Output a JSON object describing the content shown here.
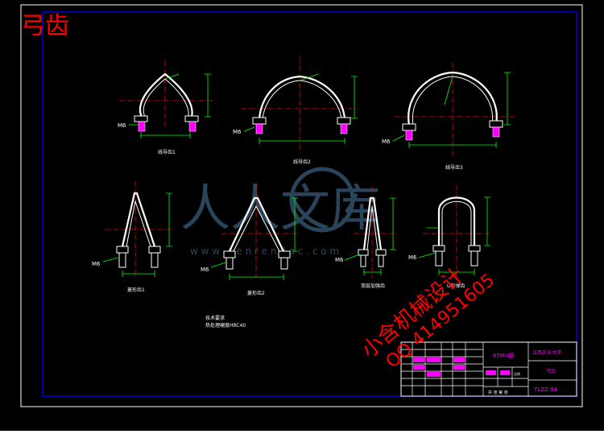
{
  "header": {
    "title": "弓齿"
  },
  "colors": {
    "background": "#000000",
    "frame": "#ffffff",
    "border": "#0000ff",
    "outline": "#ffffff",
    "center_line": "#ff0000",
    "dimension": "#00ff00",
    "label": "#ffff00",
    "title_block_text": "#ff00ff",
    "watermark_red": "#ff0000",
    "watermark_blue": "#4d7fa6"
  },
  "drawings": {
    "arc1": {
      "label": "线导齿1",
      "thread": "M6"
    },
    "arc2": {
      "label": "线导齿2",
      "thread": "M6"
    },
    "arc3": {
      "label": "线导齿3",
      "thread": "M6"
    },
    "tri1": {
      "label": "菱形齿1",
      "thread": "M6"
    },
    "tri2": {
      "label": "菱形齿2",
      "thread": "M6"
    },
    "tri3": {
      "label": "双层加强齿",
      "thread": "M6"
    },
    "u1": {
      "label": "U形弹齿",
      "thread": "M6"
    }
  },
  "notes": {
    "title": "技术要求",
    "line1": "热处理硬度HRC40"
  },
  "title_block": {
    "material": "65Mn钢",
    "school": "江西农业大学",
    "part_name": "弓齿",
    "drawing_number": "TLZZ-04",
    "scale_label": "比例",
    "sheet_label": "共 张 第 张"
  },
  "watermark": {
    "site": "人人文库",
    "url": "w w w . r e n r e n d o c . c o m",
    "shop": "小含机械设计",
    "qq": "QQ 414951605"
  }
}
